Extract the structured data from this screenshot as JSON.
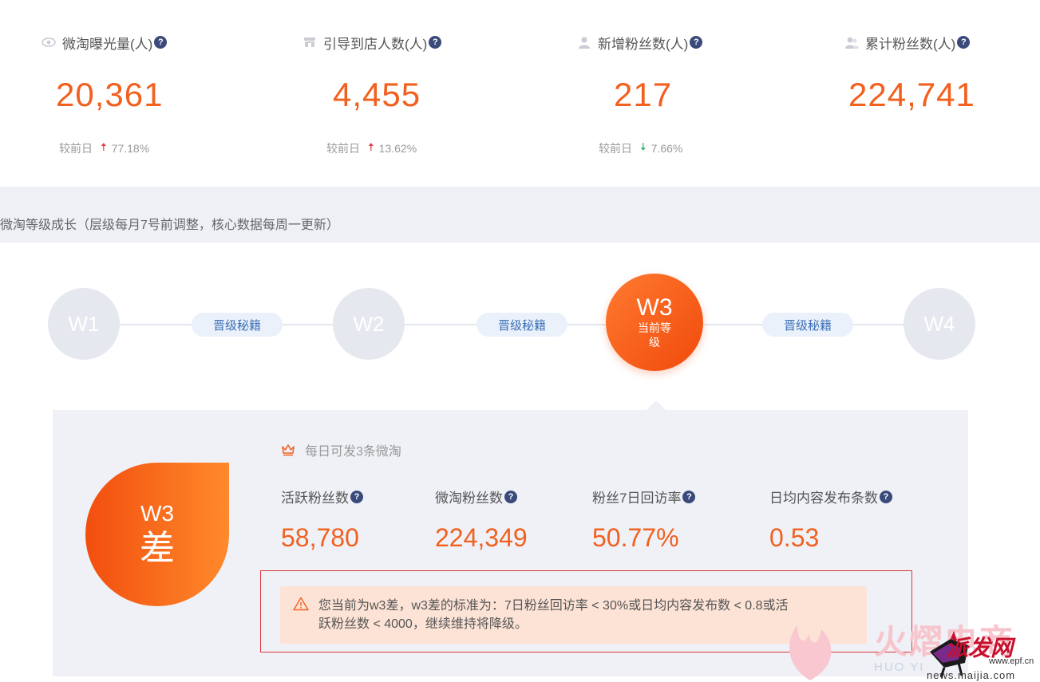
{
  "stats": [
    {
      "label": "微淘曝光量(人)",
      "value": "20,361",
      "compare_label": "较前日",
      "trend": "up",
      "change": "77.18%",
      "icon": "eye-icon"
    },
    {
      "label": "引导到店人数(人)",
      "value": "4,455",
      "compare_label": "较前日",
      "trend": "up",
      "change": "13.62%",
      "icon": "store-icon"
    },
    {
      "label": "新增粉丝数(人)",
      "value": "217",
      "compare_label": "较前日",
      "trend": "down",
      "change": "7.66%",
      "icon": "user-icon"
    },
    {
      "label": "累计粉丝数(人)",
      "value": "224,741",
      "icon": "users-icon"
    }
  ],
  "help_glyph": "?",
  "section": {
    "title": "微淘等级成长（层级每月7号前调整，核心数据每周一更新）"
  },
  "levels": {
    "items": [
      "W1",
      "W2",
      "W3",
      "W4"
    ],
    "current": "W3",
    "current_sub": "当前等级",
    "tip_label": "晋级秘籍"
  },
  "detail": {
    "badge_level": "W3",
    "badge_grade": "差",
    "perk": "每日可发3条微淘",
    "metrics": [
      {
        "label": "活跃粉丝数",
        "value": "58,780"
      },
      {
        "label": "微淘粉丝数",
        "value": "224,349"
      },
      {
        "label": "粉丝7日回访率",
        "value": "50.77%"
      },
      {
        "label": "日均内容发布条数",
        "value": "0.53"
      }
    ],
    "alert_line1": "您当前为w3差，w3差的标准为：7日粉丝回访率 < 30%或日均内容发布数 < 0.8或活",
    "alert_line2": "跃粉丝数 < 4000，继续维持将降级。"
  },
  "watermark": {
    "brand": "火熠电商",
    "brand_latin": "HUO YI",
    "site_logo": "派发网",
    "site_domain": "www.epf.cn",
    "site_url": "news.maijia.com"
  },
  "colors": {
    "accent": "#f2601f",
    "up": "#e4393c",
    "down": "#3bb273",
    "help": "#3a4a7a"
  }
}
